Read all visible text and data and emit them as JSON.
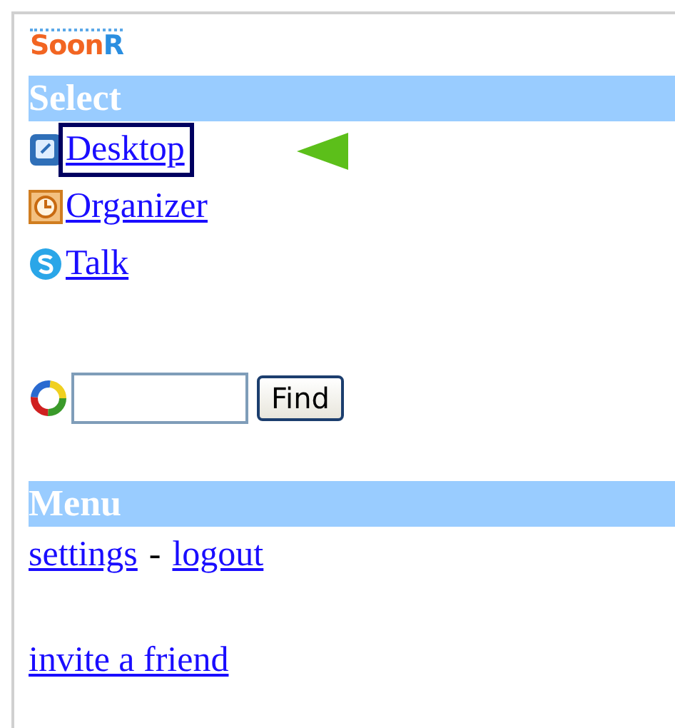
{
  "logo": {
    "main": "Soon",
    "accent": "R"
  },
  "sections": [
    {
      "title": "Select",
      "items": [
        {
          "kind": "desktop",
          "label": "Desktop",
          "selected": true
        },
        {
          "kind": "organizer",
          "label": "Organizer",
          "selected": false
        },
        {
          "kind": "talk",
          "label": " Talk",
          "selected": false
        }
      ]
    }
  ],
  "search": {
    "button": "Find"
  },
  "menu": {
    "title": "Menu",
    "links": [
      "settings",
      "logout"
    ],
    "separator": "-",
    "invite": "invite a friend"
  }
}
